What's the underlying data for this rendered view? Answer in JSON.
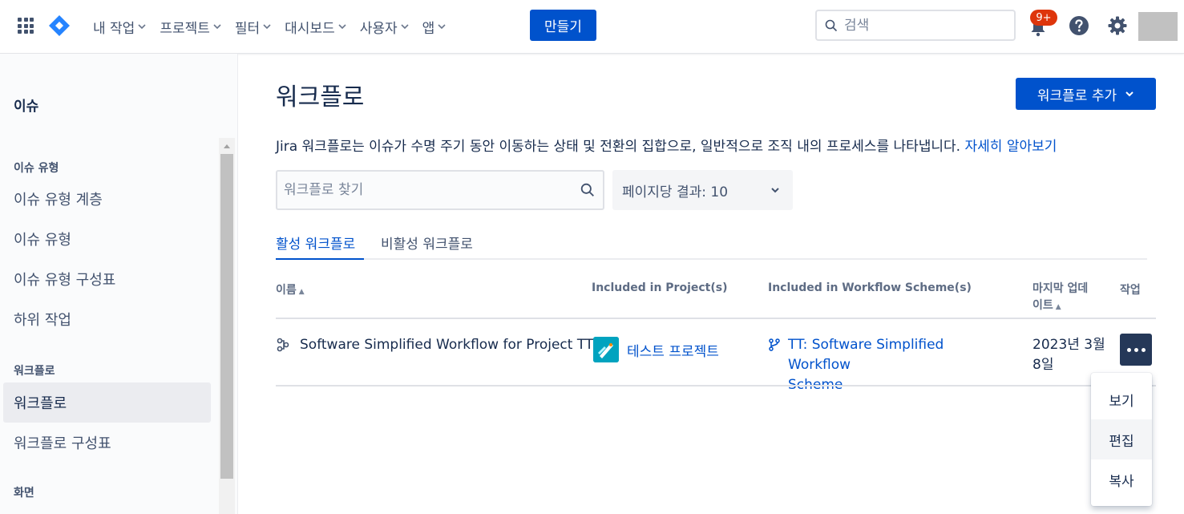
{
  "topnav": {
    "menu": [
      {
        "label": "내 작업"
      },
      {
        "label": "프로젝트"
      },
      {
        "label": "필터"
      },
      {
        "label": "대시보드"
      },
      {
        "label": "사용자"
      },
      {
        "label": "앱"
      }
    ],
    "create_label": "만들기",
    "search_placeholder": "검색",
    "notification_badge": "9+"
  },
  "sidebar": {
    "title": "이슈",
    "sections": [
      {
        "label": "이슈 유형"
      },
      {
        "label": "워크플로"
      },
      {
        "label": "화면"
      }
    ],
    "items": [
      {
        "label": "이슈 유형 계층"
      },
      {
        "label": "이슈 유형"
      },
      {
        "label": "이슈 유형 구성표"
      },
      {
        "label": "하위 작업"
      },
      {
        "label": "워크플로",
        "active": true
      },
      {
        "label": "워크플로 구성표"
      }
    ]
  },
  "main": {
    "title": "워크플로",
    "add_button": "워크플로 추가",
    "description": "Jira 워크플로는 이슈가 수명 주기 동안 이동하는 상태 및 전환의 집합으로, 일반적으로 조직 내의 프로세스를 나타냅니다.",
    "learn_more": "자세히 알아보기",
    "search_placeholder": "워크플로 찾기",
    "per_page": "페이지당 결과: 10",
    "tabs": [
      {
        "label": "활성 워크플로",
        "active": true
      },
      {
        "label": "비활성 워크플로",
        "active": false
      }
    ],
    "table": {
      "headers": {
        "name": "이름",
        "projects": "Included in Project(s)",
        "schemes": "Included in Workflow Scheme(s)",
        "updated_line1": "마지막 업데",
        "updated_line2": "이트",
        "actions": "작업"
      },
      "rows": [
        {
          "name": "Software Simplified Workflow for Project TT",
          "project": "테스트 프로젝트",
          "scheme_line1": "TT: Software Simplified Workflow",
          "scheme_line2": "Scheme",
          "date_line1": "2023년 3월",
          "date_line2": "8일"
        }
      ]
    },
    "row_menu": [
      {
        "label": "보기"
      },
      {
        "label": "편집"
      },
      {
        "label": "복사"
      }
    ]
  }
}
